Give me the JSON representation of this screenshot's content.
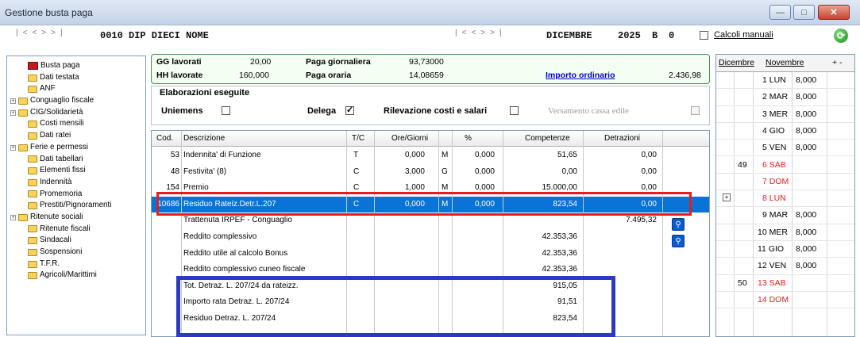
{
  "window": {
    "title": "Gestione busta paga"
  },
  "employee": {
    "code_name": "0010 DIP DIECI NOME"
  },
  "period": {
    "month": "DICEMBRE",
    "year": "2025",
    "b": "B",
    "zero": "0"
  },
  "calcoli": {
    "label": "Calcoli manuali",
    "checked": false
  },
  "tree": [
    {
      "label": "Busta paga",
      "icon": "payslip-book-icon",
      "expand": false
    },
    {
      "label": "Dati testata",
      "icon": "folder-icon",
      "expand": false
    },
    {
      "label": "ANF",
      "icon": "folder-icon",
      "expand": false
    },
    {
      "label": "Conguaglio fiscale",
      "icon": "folder-icon",
      "expand": true
    },
    {
      "label": "CIG/Solidarietà",
      "icon": "folder-icon",
      "expand": true
    },
    {
      "label": "Costi mensili",
      "icon": "folder-icon",
      "expand": false
    },
    {
      "label": "Dati ratei",
      "icon": "folder-icon",
      "expand": false
    },
    {
      "label": "Ferie e permessi",
      "icon": "folder-icon",
      "expand": true
    },
    {
      "label": "Dati tabellari",
      "icon": "folder-icon",
      "expand": false
    },
    {
      "label": "Elementi fissi",
      "icon": "folder-icon",
      "expand": false
    },
    {
      "label": "Indennità",
      "icon": "folder-icon",
      "expand": false
    },
    {
      "label": "Promemoria",
      "icon": "folder-icon",
      "expand": false
    },
    {
      "label": "Prestiti/Pignoramenti",
      "icon": "folder-icon",
      "expand": false
    },
    {
      "label": "Ritenute sociali",
      "icon": "folder-icon",
      "expand": true
    },
    {
      "label": "Ritenute fiscali",
      "icon": "folder-icon",
      "expand": false
    },
    {
      "label": "Sindacali",
      "icon": "folder-icon",
      "expand": false
    },
    {
      "label": "Sospensioni",
      "icon": "folder-icon",
      "expand": false
    },
    {
      "label": "T.F.R.",
      "icon": "folder-icon",
      "expand": false
    },
    {
      "label": "Agricoli/Marittimi",
      "icon": "folder-icon",
      "expand": false
    }
  ],
  "summary": {
    "gg_label": "GG lavorati",
    "gg_value": "20,00",
    "hh_label": "HH lavorate",
    "hh_value": "160,000",
    "pg_label": "Paga giornaliera",
    "pg_value": "93,73000",
    "po_label": "Paga oraria",
    "po_value": "14,08659",
    "imp_label": "Importo ordinario",
    "imp_value": "2.436,98"
  },
  "elaborazioni": {
    "title": "Elaborazioni eseguite",
    "uniemens": "Uniemens",
    "uniemens_checked": false,
    "delega": "Delega",
    "delega_checked": true,
    "rilevazione": "Rilevazione costi e salari",
    "rilevazione_checked": false,
    "versamento": "Versamento cassa edile",
    "versamento_checked": false
  },
  "grid": {
    "headers": [
      "Cod.",
      "Descrizione",
      "T/C",
      "Ore/Giorni",
      "",
      "%",
      "Competenze",
      "Detrazioni"
    ],
    "rows": [
      {
        "cod": "53",
        "desc": "Indennita' di Funzione",
        "tc": "T",
        "ore": "0,000",
        "u": "M",
        "pct": "0,000",
        "comp": "51,65",
        "detr": "0,00",
        "selected": false
      },
      {
        "cod": "48",
        "desc": "Festivita' (8)",
        "tc": "C",
        "ore": "3,000",
        "u": "G",
        "pct": "0,000",
        "comp": "0,00",
        "detr": "0,00",
        "selected": false
      },
      {
        "cod": "154",
        "desc": "Premio",
        "tc": "C",
        "ore": "1,000",
        "u": "M",
        "pct": "0,000",
        "comp": "15.000,00",
        "detr": "0,00",
        "selected": false
      },
      {
        "cod": "10686",
        "desc": "Residuo Rateiz.Detr.L.207",
        "tc": "C",
        "ore": "0,000",
        "u": "M",
        "pct": "0,000",
        "comp": "823,54",
        "detr": "0,00",
        "selected": true
      },
      {
        "cod": "",
        "desc": "Trattenuta IRPEF - Conguaglio",
        "tc": "",
        "ore": "",
        "u": "",
        "pct": "",
        "comp": "",
        "detr": "7.495,32",
        "selected": false
      },
      {
        "cod": "",
        "desc": "Reddito complessivo",
        "tc": "",
        "ore": "",
        "u": "",
        "pct": "",
        "comp": "42.353,36",
        "detr": "",
        "selected": false
      },
      {
        "cod": "",
        "desc": "Reddito utile al calcolo Bonus",
        "tc": "",
        "ore": "",
        "u": "",
        "pct": "",
        "comp": "42.353,36",
        "detr": "",
        "selected": false
      },
      {
        "cod": "",
        "desc": "Reddito complessivo cuneo fiscale",
        "tc": "",
        "ore": "",
        "u": "",
        "pct": "",
        "comp": "42.353,36",
        "detr": "",
        "selected": false
      },
      {
        "cod": "",
        "desc": "Tot. Detraz. L. 207/24 da rateizz.",
        "tc": "",
        "ore": "",
        "u": "",
        "pct": "",
        "comp": "915,05",
        "detr": "",
        "selected": false
      },
      {
        "cod": "",
        "desc": "Importo rata Detraz. L. 207/24",
        "tc": "",
        "ore": "",
        "u": "",
        "pct": "",
        "comp": "91,51",
        "detr": "",
        "selected": false
      },
      {
        "cod": "",
        "desc": "Residuo Detraz. L. 207/24",
        "tc": "",
        "ore": "",
        "u": "",
        "pct": "",
        "comp": "823,54",
        "detr": "",
        "selected": false
      }
    ]
  },
  "calendar": {
    "tab1": "Dicembre",
    "tab2": "Novembre",
    "tab3": "+ -",
    "days": [
      {
        "week": "",
        "day": "1 LUN",
        "hours": "8,000",
        "red": false
      },
      {
        "week": "",
        "day": "2 MAR",
        "hours": "8,000",
        "red": false
      },
      {
        "week": "",
        "day": "3 MER",
        "hours": "8,000",
        "red": false
      },
      {
        "week": "",
        "day": "4 GIO",
        "hours": "8,000",
        "red": false
      },
      {
        "week": "",
        "day": "5 VEN",
        "hours": "8,000",
        "red": false
      },
      {
        "week": "49",
        "day": "6 SAB",
        "hours": "",
        "red": true
      },
      {
        "week": "",
        "day": "7 DOM",
        "hours": "",
        "red": true
      },
      {
        "week": "",
        "day": "8 LUN",
        "hours": "",
        "red": true
      },
      {
        "week": "",
        "day": "9 MAR",
        "hours": "8,000",
        "red": false
      },
      {
        "week": "",
        "day": "10 MER",
        "hours": "8,000",
        "red": false
      },
      {
        "week": "",
        "day": "11 GIO",
        "hours": "8,000",
        "red": false
      },
      {
        "week": "",
        "day": "12 VEN",
        "hours": "8,000",
        "red": false
      },
      {
        "week": "50",
        "day": "13 SAB",
        "hours": "",
        "red": true
      },
      {
        "week": "",
        "day": "14 DOM",
        "hours": "",
        "red": true
      }
    ]
  }
}
